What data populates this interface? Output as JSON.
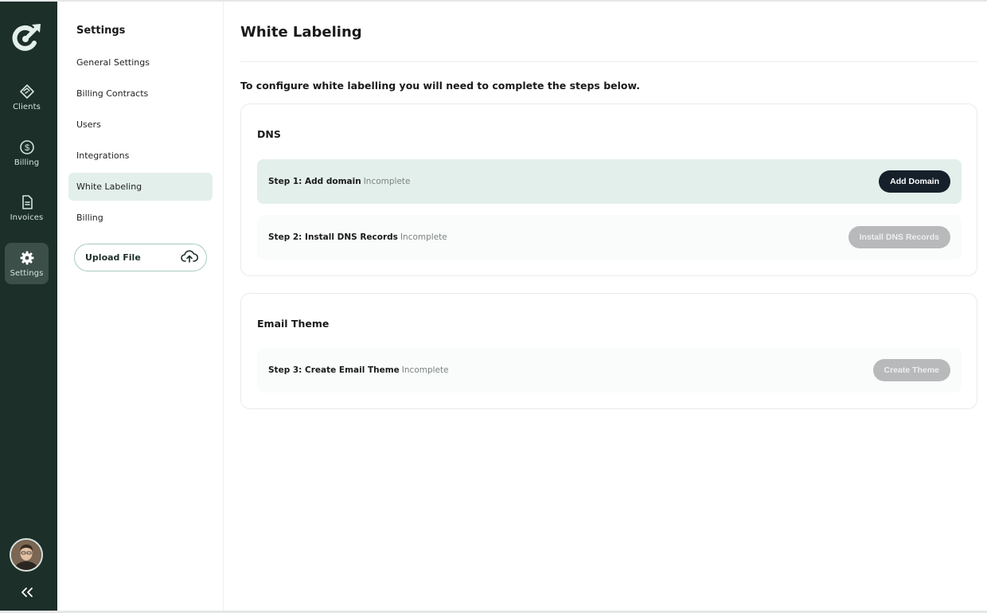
{
  "rail": {
    "items": [
      {
        "label": "Clients",
        "icon": "handshake-icon"
      },
      {
        "label": "Billing",
        "icon": "dollar-circle-icon"
      },
      {
        "label": "Invoices",
        "icon": "document-icon"
      },
      {
        "label": "Settings",
        "icon": "gear-icon"
      }
    ],
    "active": "Settings"
  },
  "settings_nav": {
    "title": "Settings",
    "items": [
      {
        "label": "General Settings"
      },
      {
        "label": "Billing Contracts"
      },
      {
        "label": "Users"
      },
      {
        "label": "Integrations"
      },
      {
        "label": "White Labeling"
      },
      {
        "label": "Billing"
      }
    ],
    "active": "White Labeling",
    "upload_label": "Upload File"
  },
  "main": {
    "title": "White Labeling",
    "intro": "To configure white labelling you will need to complete the steps below.",
    "dns_card": {
      "title": "DNS",
      "steps": [
        {
          "name": "Step 1: Add domain",
          "status": "Incomplete",
          "button": "Add Domain"
        },
        {
          "name": "Step 2: Install DNS Records",
          "status": "Incomplete",
          "button": "Install DNS Records"
        }
      ]
    },
    "email_card": {
      "title": "Email Theme",
      "steps": [
        {
          "name": "Step 3: Create Email Theme",
          "status": "Incomplete",
          "button": "Create Theme"
        }
      ]
    }
  },
  "colors": {
    "rail_bg": "#1c2f29",
    "accent_light": "#e3efeb",
    "primary_button": "#16202a",
    "disabled_button": "#b7b9ba"
  }
}
